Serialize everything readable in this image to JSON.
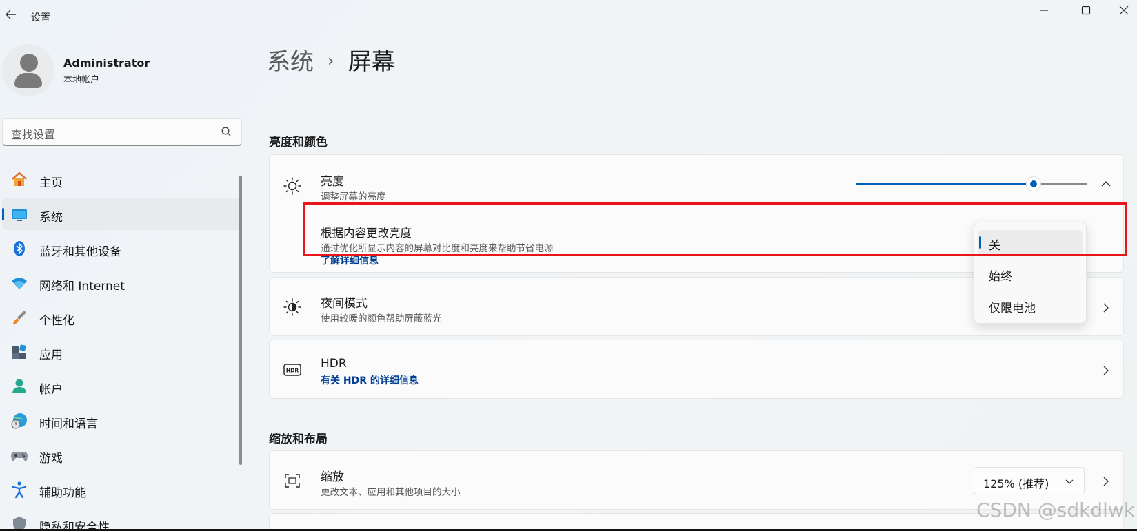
{
  "window": {
    "title": "设置",
    "back_icon": "back-arrow-icon",
    "controls": [
      "minimize-icon",
      "maximize-icon",
      "close-icon"
    ]
  },
  "user": {
    "name": "Administrator",
    "subtitle": "本地帐户"
  },
  "search": {
    "placeholder": "查找设置"
  },
  "sidebar": {
    "items": [
      {
        "label": "主页",
        "icon": "home-icon",
        "active": false
      },
      {
        "label": "系统",
        "icon": "system-display-icon",
        "active": true
      },
      {
        "label": "蓝牙和其他设备",
        "icon": "bluetooth-icon",
        "active": false
      },
      {
        "label": "网络和 Internet",
        "icon": "wifi-icon",
        "active": false
      },
      {
        "label": "个性化",
        "icon": "brush-icon",
        "active": false
      },
      {
        "label": "应用",
        "icon": "apps-icon",
        "active": false
      },
      {
        "label": "帐户",
        "icon": "account-icon",
        "active": false
      },
      {
        "label": "时间和语言",
        "icon": "globe-clock-icon",
        "active": false
      },
      {
        "label": "游戏",
        "icon": "gamepad-icon",
        "active": false
      },
      {
        "label": "辅助功能",
        "icon": "accessibility-icon",
        "active": false
      },
      {
        "label": "隐私和安全性",
        "icon": "shield-icon",
        "active": false
      }
    ]
  },
  "breadcrumb": {
    "parent": "系统",
    "separator": "›",
    "current": "屏幕"
  },
  "sections": {
    "brightness_color": "亮度和颜色",
    "scale_layout": "缩放和布局"
  },
  "brightness": {
    "title": "亮度",
    "subtitle": "调整屏幕的亮度",
    "value_fraction": 0.77,
    "content_adaptive": {
      "title": "根据内容更改亮度",
      "subtitle": "通过优化所显示内容的屏幕对比度和亮度来帮助节省电源",
      "link": "了解详细信息"
    }
  },
  "dropdown": {
    "options": [
      "关",
      "始终",
      "仅限电池"
    ],
    "selected": "关"
  },
  "night_mode": {
    "title": "夜间模式",
    "subtitle": "使用较暖的颜色帮助屏蔽蓝光"
  },
  "hdr": {
    "title": "HDR",
    "link": "有关 HDR 的详细信息"
  },
  "scale": {
    "title": "缩放",
    "subtitle": "更改文本、应用和其他项目的大小",
    "value": "125% (推荐)"
  },
  "watermark": "CSDN @sdkdlwk",
  "colors": {
    "accent": "#005fb8",
    "link": "#003e92",
    "highlight_box": "#e8161b"
  }
}
